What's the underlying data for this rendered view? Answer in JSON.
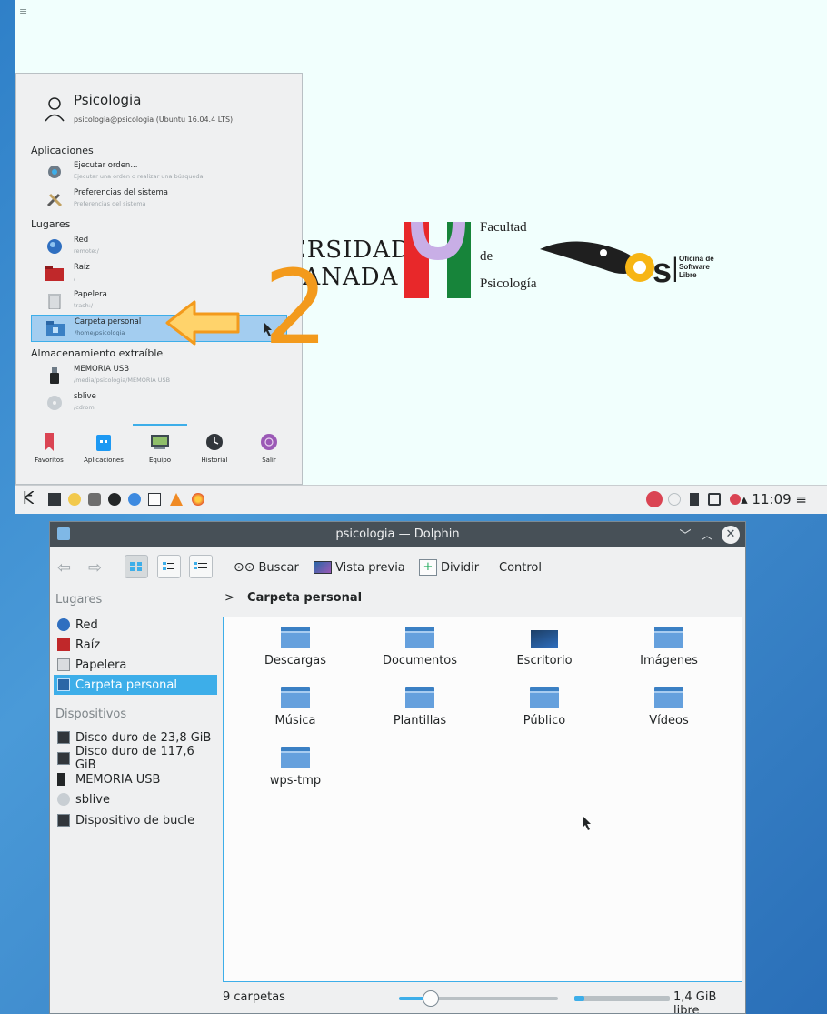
{
  "top_desktop": {
    "corner_menu_icon": "hamburger-icon",
    "logos": {
      "ugr_line1": "UNIVERSIDAD",
      "ugr_line2": "DE GRANADA",
      "psi_line1": "Facultad",
      "psi_line2": "de",
      "psi_line3": "Psicología",
      "osl_line1": "Oficina de",
      "osl_line2": "Software",
      "osl_line3": "Libre"
    },
    "annotation_number": "2"
  },
  "kickoff": {
    "user_name": "Psicologia",
    "user_host": "psicologia@psicologia (Ubuntu 16.04.4 LTS)",
    "sections": {
      "apps": "Aplicaciones",
      "places": "Lugares",
      "removable": "Almacenamiento extraíble"
    },
    "items": [
      {
        "title": "Ejecutar orden...",
        "subtitle": "Ejecutar una orden o realizar una búsqueda",
        "icon": "run-command-icon"
      },
      {
        "title": "Preferencias del sistema",
        "subtitle": "Preferencias del sistema",
        "icon": "system-settings-icon"
      },
      {
        "title": "Red",
        "subtitle": "remote:/",
        "icon": "network-globe-icon"
      },
      {
        "title": "Raíz",
        "subtitle": "/",
        "icon": "root-folder-icon"
      },
      {
        "title": "Papelera",
        "subtitle": "trash:/",
        "icon": "trash-icon"
      },
      {
        "title": "Carpeta personal",
        "subtitle": "/home/psicologia",
        "icon": "home-folder-icon"
      },
      {
        "title": "MEMORIA USB",
        "subtitle": "/media/psicologia/MEMORIA USB",
        "icon": "usb-drive-icon"
      },
      {
        "title": "sblive",
        "subtitle": "/cdrom",
        "icon": "optical-disc-icon"
      }
    ],
    "tabs": [
      {
        "label": "Favoritos",
        "icon": "bookmark-icon"
      },
      {
        "label": "Aplicaciones",
        "icon": "applications-icon"
      },
      {
        "label": "Equipo",
        "icon": "computer-icon"
      },
      {
        "label": "Historial",
        "icon": "history-clock-icon"
      },
      {
        "label": "Salir",
        "icon": "leave-icon"
      }
    ]
  },
  "panel": {
    "clock": "▴ 11:09 ≡"
  },
  "dolphin": {
    "title": "psicologia — Dolphin",
    "toolbar": {
      "search": "Buscar",
      "preview": "Vista previa",
      "split": "Dividir",
      "control": "Control"
    },
    "places": {
      "heading_places": "Lugares",
      "places_items": [
        "Red",
        "Raíz",
        "Papelera",
        "Carpeta personal"
      ],
      "heading_devices": "Dispositivos",
      "device_items": [
        "Disco duro de 23,8 GiB",
        "Disco duro de 117,6 GiB",
        "MEMORIA USB",
        "sblive",
        "Dispositivo de bucle"
      ]
    },
    "breadcrumb": {
      "separator": ">",
      "current": "Carpeta personal"
    },
    "files": [
      "Descargas",
      "Documentos",
      "Escritorio",
      "Imágenes",
      "Música",
      "Plantillas",
      "Público",
      "Vídeos",
      "wps-tmp"
    ],
    "status": {
      "count": "9 carpetas",
      "free": "1,4 GiB libre",
      "zoom_fraction": 0.2,
      "used_fraction": 0.1
    }
  },
  "colors": {
    "accent": "#3daee9",
    "titlebar": "#475057",
    "annotation": "#f39a1c"
  }
}
